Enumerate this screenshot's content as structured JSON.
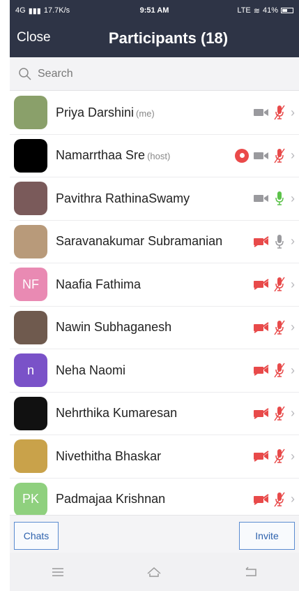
{
  "status_bar": {
    "network": "4G",
    "speed": "17.7K/s",
    "time": "9:51 AM",
    "battery": "41%",
    "lte": "LTE"
  },
  "header": {
    "close_label": "Close",
    "title": "Participants (18)"
  },
  "search": {
    "placeholder": "Search"
  },
  "participants": [
    {
      "name": "Priya Darshini",
      "tag": "(me)",
      "avatar_color": "#8aa06a",
      "initials": "",
      "video": "on",
      "mic": "muted",
      "recording": false
    },
    {
      "name": "Namarrthaa Sre",
      "tag": "(host)",
      "avatar_color": "#000000",
      "initials": "",
      "video": "on",
      "mic": "muted",
      "recording": true
    },
    {
      "name": "Pavithra RathinaSwamy",
      "tag": "",
      "avatar_color": "#7a5a5a",
      "initials": "",
      "video": "on",
      "mic": "active",
      "recording": false
    },
    {
      "name": "Saravanakumar Subramanian",
      "tag": "",
      "avatar_color": "#b89a7a",
      "initials": "",
      "video": "off",
      "mic": "idle",
      "recording": false
    },
    {
      "name": "Naafia Fathima",
      "tag": "",
      "avatar_color": "#e98ab3",
      "initials": "NF",
      "video": "off",
      "mic": "muted",
      "recording": false
    },
    {
      "name": "Nawin Subhaganesh",
      "tag": "",
      "avatar_color": "#6f5a4e",
      "initials": "",
      "video": "off",
      "mic": "muted",
      "recording": false
    },
    {
      "name": "Neha Naomi",
      "tag": "",
      "avatar_color": "#7a52c8",
      "initials": "n",
      "video": "off",
      "mic": "muted",
      "recording": false
    },
    {
      "name": "Nehrthika Kumaresan",
      "tag": "",
      "avatar_color": "#111111",
      "initials": "",
      "video": "off",
      "mic": "muted",
      "recording": false
    },
    {
      "name": "Nivethitha Bhaskar",
      "tag": "",
      "avatar_color": "#c9a24a",
      "initials": "",
      "video": "off",
      "mic": "muted",
      "recording": false
    },
    {
      "name": "Padmajaa Krishnan",
      "tag": "",
      "avatar_color": "#8fd07e",
      "initials": "PK",
      "video": "off",
      "mic": "muted",
      "recording": false
    }
  ],
  "footer": {
    "chats_label": "Chats",
    "invite_label": "Invite"
  },
  "colors": {
    "header_bg": "#2e3446",
    "accent_blue": "#2e62ad",
    "muted_red": "#e84a4a",
    "active_green": "#5cc24a",
    "icon_grey": "#9a9a9e"
  }
}
